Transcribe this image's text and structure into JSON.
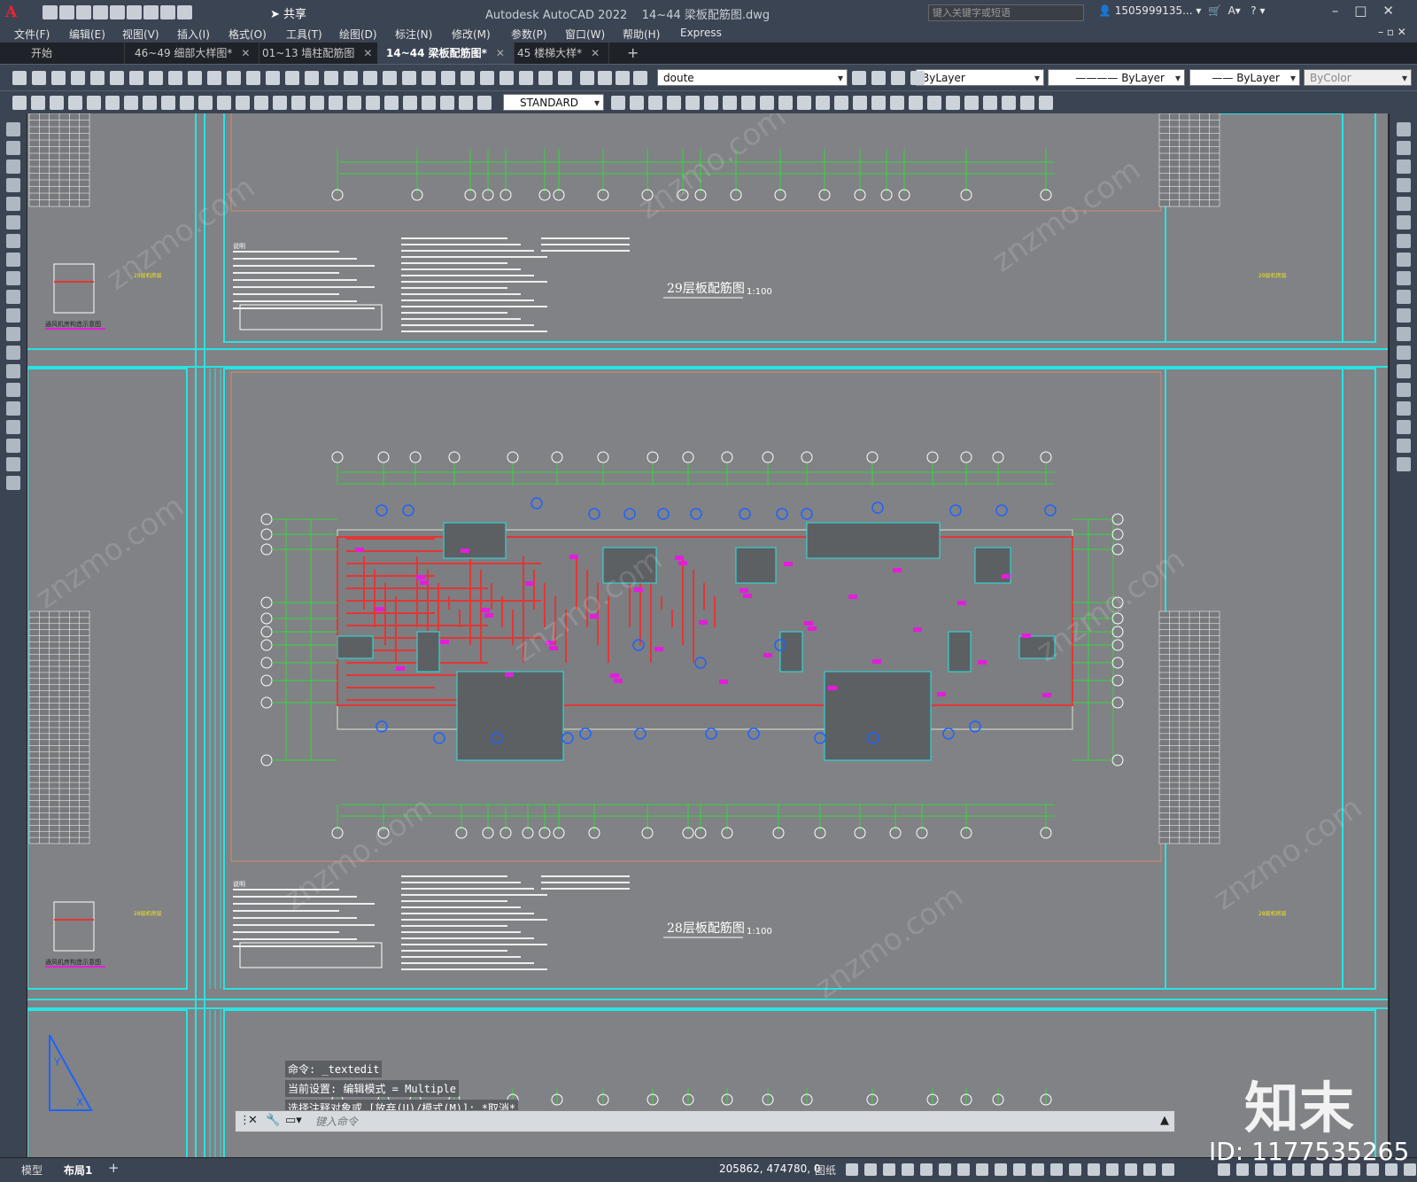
{
  "titlebar": {
    "app_title": "Autodesk AutoCAD 2022",
    "file_title": "14~44 梁板配筋图.dwg",
    "share_label": "共享",
    "search_placeholder": "键入关键字或短语",
    "user_label": "1505999135..."
  },
  "menu": [
    "文件(F)",
    "编辑(E)",
    "视图(V)",
    "插入(I)",
    "格式(O)",
    "工具(T)",
    "绘图(D)",
    "标注(N)",
    "修改(M)",
    "参数(P)",
    "窗口(W)",
    "帮助(H)",
    "Express"
  ],
  "tabs": [
    {
      "label": "开始",
      "active": false
    },
    {
      "label": "46~49 细部大样图*",
      "active": false
    },
    {
      "label": "01~13 墙柱配筋图",
      "active": false
    },
    {
      "label": "14~44 梁板配筋图*",
      "active": true
    },
    {
      "label": "45 楼梯大样*",
      "active": false
    }
  ],
  "toolbar1": {
    "layer_name": "doute",
    "color_value": "ByLayer",
    "linetype_value": "ByLayer",
    "lineweight_value": "ByLayer",
    "plotstyle_value": "ByColor"
  },
  "toolbar2": {
    "text_style": "STANDARD"
  },
  "drawing": {
    "plan_top_title": "29层板配筋图",
    "plan_top_scale": "1:100",
    "plan_bottom_title": "28层板配筋图",
    "plan_bottom_scale": "1:100",
    "notes_heading": "说明",
    "left_caption": "通风机房构造示意图",
    "small_label_top": "29层机房层",
    "small_label_bottom": "28层机房层"
  },
  "command": {
    "history": [
      "命令: _textedit",
      "当前设置: 编辑模式 = Multiple",
      "选择注释对象或 [放弃(U)/模式(M)]: *取消*"
    ],
    "placeholder": "键入命令"
  },
  "status": {
    "tab_model": "模型",
    "tab_layout": "布局1",
    "coordinates": "205862, 474780, 0",
    "paper_label": "图纸"
  },
  "watermark": {
    "logo": "知末",
    "id": "ID: 1177535265",
    "site": "znzmo.com"
  },
  "colors": {
    "canvas": "#808285",
    "frame": "#27e3e3",
    "dim": "#39d43d",
    "beam": "#e33636",
    "grid_bubble": "#1e63ff",
    "label": "#e41cdc",
    "ui_dark": "#3b4453"
  }
}
